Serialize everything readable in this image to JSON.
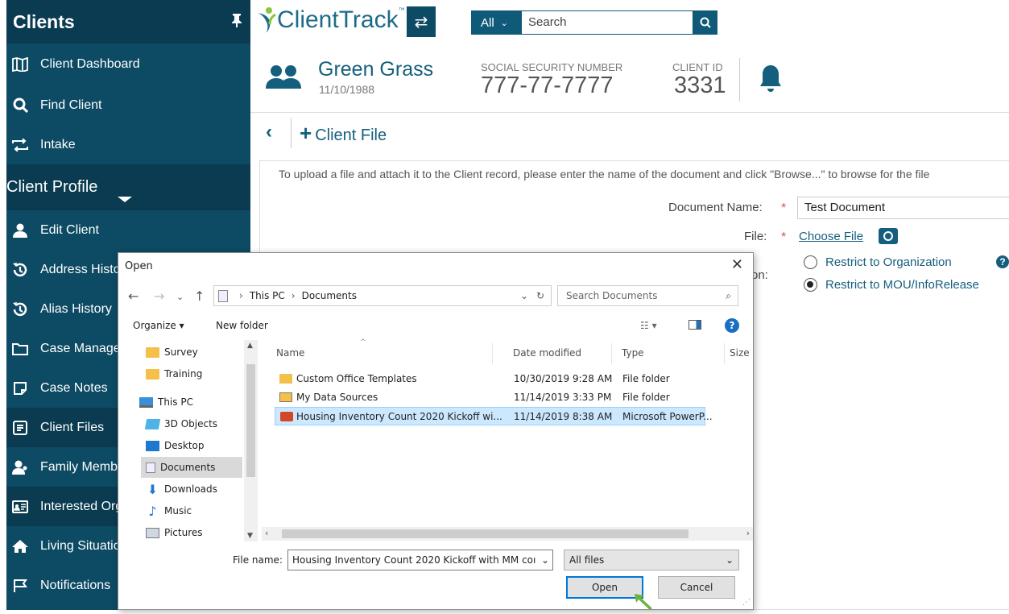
{
  "sidebar": {
    "title": "Clients",
    "pin_icon": "pin-icon",
    "items": [
      {
        "label": "Client Dashboard",
        "icon": "map-icon"
      },
      {
        "label": "Find Client",
        "icon": "search-icon"
      },
      {
        "label": "Intake",
        "icon": "swap-icon"
      }
    ],
    "section_title": "Client Profile",
    "profile_items": [
      {
        "label": "Edit Client",
        "icon": "user-icon"
      },
      {
        "label": "Address History",
        "icon": "history-icon"
      },
      {
        "label": "Alias History",
        "icon": "history-icon"
      },
      {
        "label": "Case Management",
        "icon": "folder-icon"
      },
      {
        "label": "Case Notes",
        "icon": "note-icon"
      },
      {
        "label": "Client Files",
        "icon": "file-icon"
      },
      {
        "label": "Family Members",
        "icon": "family-icon"
      },
      {
        "label": "Interested Organizations",
        "icon": "id-card-icon"
      },
      {
        "label": "Living Situation",
        "icon": "home-icon"
      },
      {
        "label": "Notifications",
        "icon": "flag-icon"
      }
    ]
  },
  "topbar": {
    "logo": "ClientTrack",
    "logo_tm": "™",
    "search_scope": "All",
    "search_placeholder": "Search"
  },
  "client": {
    "name": "Green Grass",
    "dob": "11/10/1988",
    "ssn_label": "SOCIAL SECURITY NUMBER",
    "ssn": "777-77-7777",
    "id_label": "CLIENT ID",
    "id": "3331"
  },
  "page": {
    "title": "Client File",
    "instructions": "To upload a file and attach it to the Client record, please enter the name of the document and click \"Browse...\" to browse for the file",
    "document_name_label": "Document Name:",
    "document_name_value": "Test Document",
    "file_label": "File:",
    "choose_file": "Choose File",
    "partial_label": "on:",
    "restrict_org": "Restrict to Organization",
    "restrict_mou": "Restrict to MOU/InfoRelease"
  },
  "dialog": {
    "title": "Open",
    "path": [
      "This PC",
      "Documents"
    ],
    "search_placeholder": "Search Documents",
    "organize": "Organize ▾",
    "new_folder": "New folder",
    "tree": [
      {
        "label": "Survey",
        "type": "folder"
      },
      {
        "label": "Training",
        "type": "folder"
      },
      {
        "label": "This PC",
        "type": "pc"
      },
      {
        "label": "3D Objects",
        "type": "3d"
      },
      {
        "label": "Desktop",
        "type": "desktop"
      },
      {
        "label": "Documents",
        "type": "docs"
      },
      {
        "label": "Downloads",
        "type": "download"
      },
      {
        "label": "Music",
        "type": "music"
      },
      {
        "label": "Pictures",
        "type": "pictures"
      }
    ],
    "columns": [
      "Name",
      "Date modified",
      "Type",
      "Size"
    ],
    "files": [
      {
        "name": "Custom Office Templates",
        "date": "10/30/2019 9:28 AM",
        "type": "File folder",
        "kind": "folder"
      },
      {
        "name": "My Data Sources",
        "date": "11/14/2019 3:33 PM",
        "type": "File folder",
        "kind": "datasource"
      },
      {
        "name": "Housing Inventory Count 2020 Kickoff wi...",
        "date": "11/14/2019 8:38 AM",
        "type": "Microsoft PowerP...",
        "kind": "pptx"
      }
    ],
    "file_name_label": "File name:",
    "file_name_value": "Housing Inventory Count 2020 Kickoff with MM coı",
    "filter": "All files",
    "open_label": "Open",
    "cancel_label": "Cancel"
  },
  "colors": {
    "sidebar": "#0d4a63",
    "accent": "#155f7e",
    "selection": "#cce8ff"
  }
}
